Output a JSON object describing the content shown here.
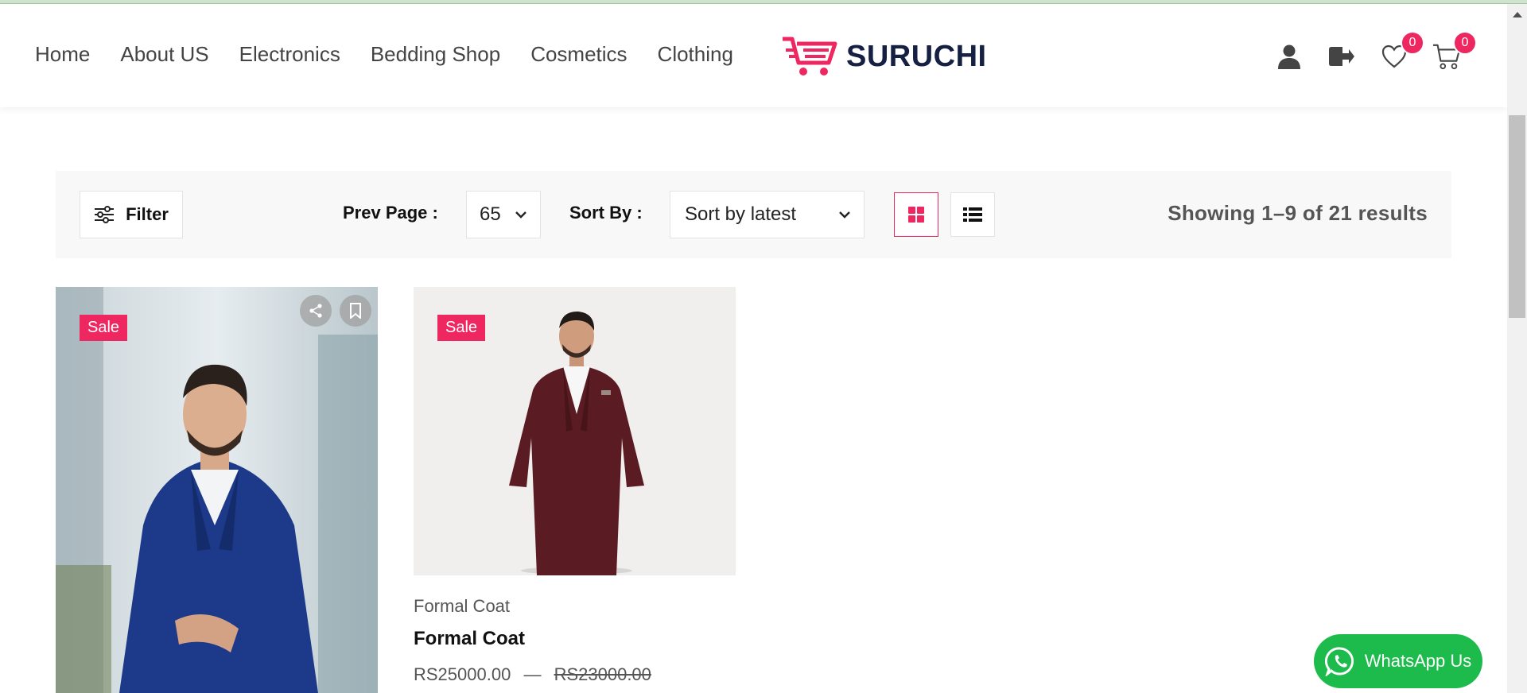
{
  "nav": {
    "items": [
      "Home",
      "About US",
      "Electronics",
      "Bedding Shop",
      "Cosmetics",
      "Clothing"
    ]
  },
  "logo": {
    "text": "SURUCHI",
    "brand_color": "#ee2761",
    "text_color": "#152042"
  },
  "header_icons": {
    "account": "user-icon",
    "logout": "logout-icon",
    "wishlist": {
      "icon": "heart-icon",
      "count": "0"
    },
    "cart": {
      "icon": "cart-icon",
      "count": "0"
    }
  },
  "toolbar": {
    "filter_label": "Filter",
    "prev_page_label": "Prev Page :",
    "per_page_value": "65",
    "sort_label": "Sort By :",
    "sort_value": "Sort by latest",
    "results_text": "Showing 1–9 of 21 results"
  },
  "products": [
    {
      "sale_label": "Sale",
      "category": "",
      "title": "",
      "price": "",
      "old_price": ""
    },
    {
      "sale_label": "Sale",
      "category": "Formal Coat",
      "title": "Formal Coat",
      "price": "RS25000.00",
      "separator": "—",
      "old_price": "RS23000.00"
    }
  ],
  "whatsapp": {
    "label": "WhatsApp Us",
    "color": "#1dbb4c"
  },
  "colors": {
    "accent": "#ee2761"
  }
}
